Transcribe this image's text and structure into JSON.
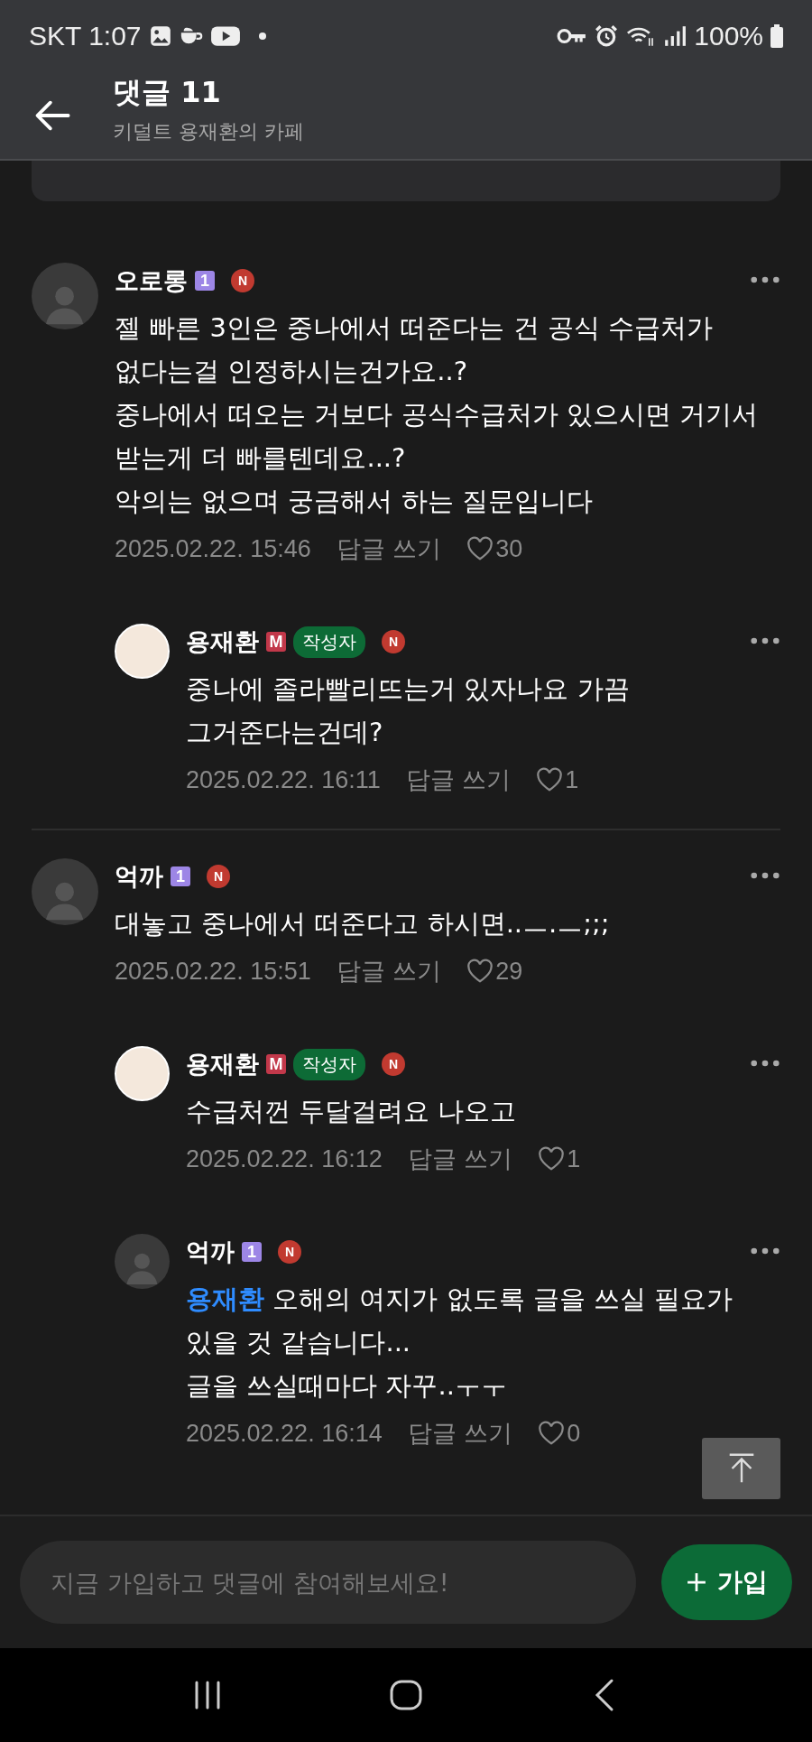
{
  "status_bar": {
    "carrier_time": "SKT 1:07",
    "battery": "100%"
  },
  "header": {
    "title": "댓글 11",
    "subtitle": "키덜트 용재환의 카페"
  },
  "threads": [
    {
      "author": "오로롱",
      "has_photo": false,
      "badges": [
        {
          "kind": "level",
          "text": "1"
        }
      ],
      "new_mark": "N",
      "lines": [
        "젤 빠른 3인은 중나에서 떠준다는 건 공식 수급처가",
        "없다는걸 인정하시는건가요..?",
        "중나에서 떠오는 거보다 공식수급처가 있으시면 거기서",
        "받는게 더 빠를텐데요...?",
        "악의는 없으며 궁금해서 하는 질문입니다"
      ],
      "date": "2025.02.22. 15:46",
      "reply_label": "답글 쓰기",
      "likes": "30",
      "children": [
        {
          "author": "용재환",
          "has_photo": true,
          "badges": [
            {
              "kind": "manager",
              "text": "M"
            }
          ],
          "author_tag": "작성자",
          "new_mark": "N",
          "lines": [
            "중나에 졸라빨리뜨는거 있자나요 가끔",
            "그거준다는건데?"
          ],
          "date": "2025.02.22. 16:11",
          "reply_label": "답글 쓰기",
          "likes": "1"
        }
      ]
    },
    {
      "author": "억까",
      "has_photo": false,
      "badges": [
        {
          "kind": "level",
          "text": "1"
        }
      ],
      "new_mark": "N",
      "lines": [
        "대놓고 중나에서 떠준다고 하시면..ㅡ.ㅡ;;;"
      ],
      "date": "2025.02.22. 15:51",
      "reply_label": "답글 쓰기",
      "likes": "29",
      "children": [
        {
          "author": "용재환",
          "has_photo": true,
          "badges": [
            {
              "kind": "manager",
              "text": "M"
            }
          ],
          "author_tag": "작성자",
          "new_mark": "N",
          "lines": [
            "수급처껀 두달걸려요 나오고"
          ],
          "date": "2025.02.22. 16:12",
          "reply_label": "답글 쓰기",
          "likes": "1"
        },
        {
          "author": "억까",
          "has_photo": false,
          "badges": [
            {
              "kind": "level",
              "text": "1"
            }
          ],
          "new_mark": "N",
          "mention": "용재환",
          "lines": [
            "오해의 여지가 없도록 글을 쓰실 필요가",
            "있을 것 같습니다...",
            "글을 쓰실때마다 자꾸..ㅜㅜ"
          ],
          "date": "2025.02.22. 16:14",
          "reply_label": "답글 쓰기",
          "likes": "0"
        }
      ]
    }
  ],
  "footer": {
    "placeholder": "지금 가입하고 댓글에 참여해보세요!",
    "join_label": "가입"
  }
}
